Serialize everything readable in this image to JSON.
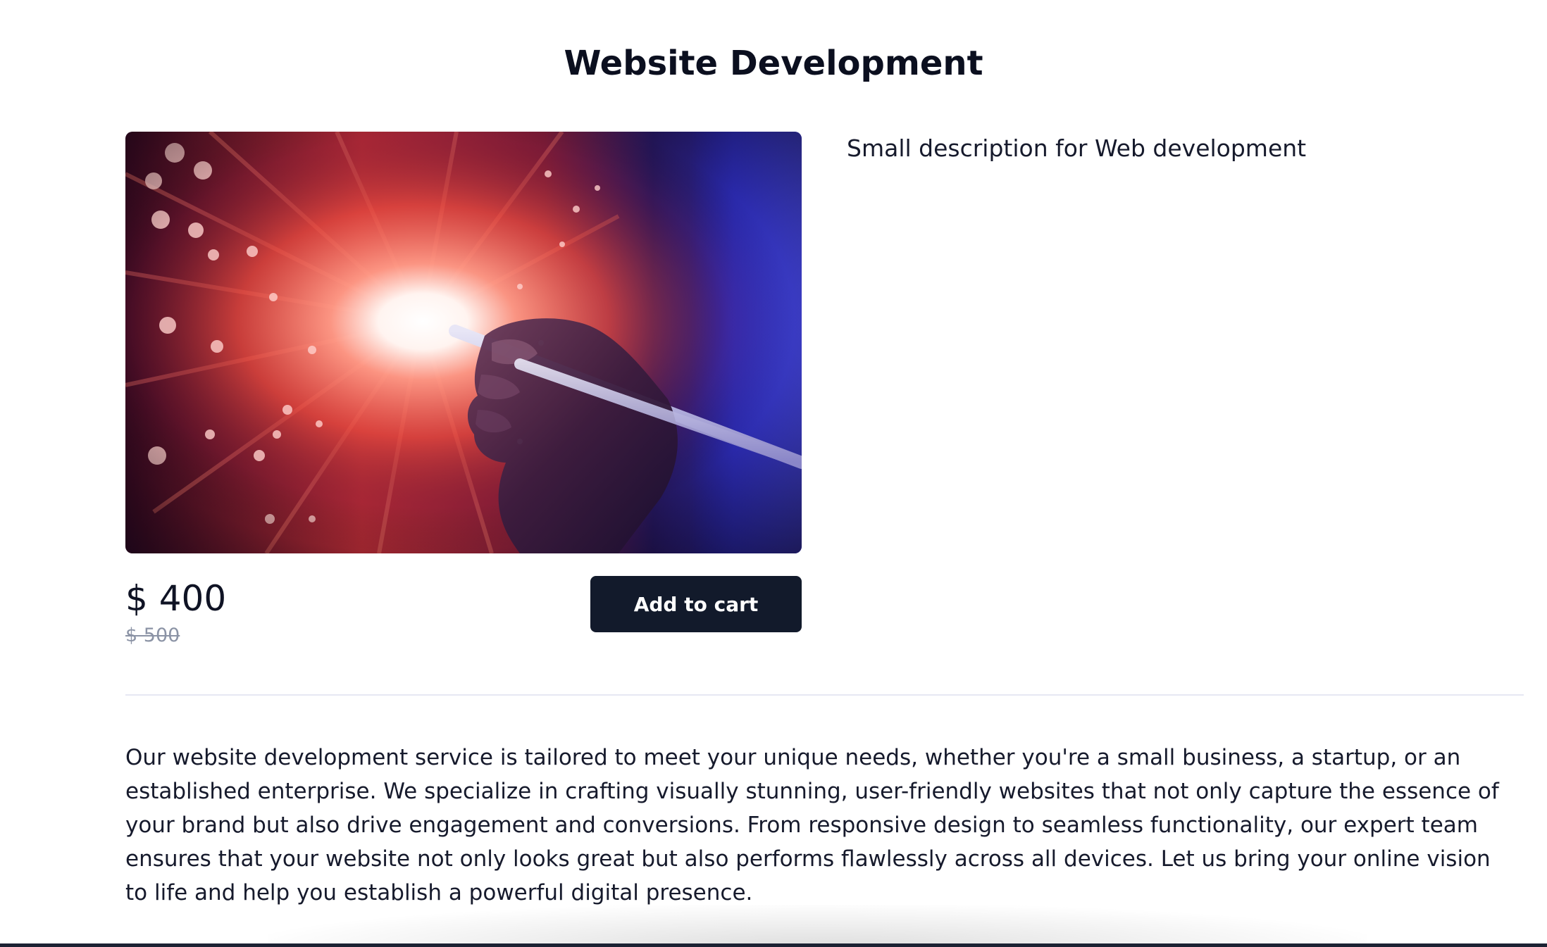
{
  "product": {
    "title": "Website Development",
    "short_description": "Small description for Web development",
    "price_current": "$ 400",
    "price_old": "$ 500",
    "add_to_cart_label": "Add to cart",
    "long_description": "Our website development service is tailored to meet your unique needs, whether you're a small business, a startup, or an established enterprise. We specialize in crafting visually stunning, user-friendly websites that not only capture the essence of your brand but also drive engagement and conversions. From responsive design to seamless functionality, our expert team ensures that your website not only looks great but also performs flawlessly across all devices. Let us bring your online vision to life and help you establish a powerful digital presence."
  },
  "image": {
    "subject": "hand holding a stylus in front of a burst of red fiber-optic light on a blue background"
  },
  "colors": {
    "button_bg": "#121a2b",
    "button_text": "#ffffff",
    "title_text": "#0b0f1f",
    "old_price": "#8b93a5",
    "divider": "#e6e8f3"
  }
}
